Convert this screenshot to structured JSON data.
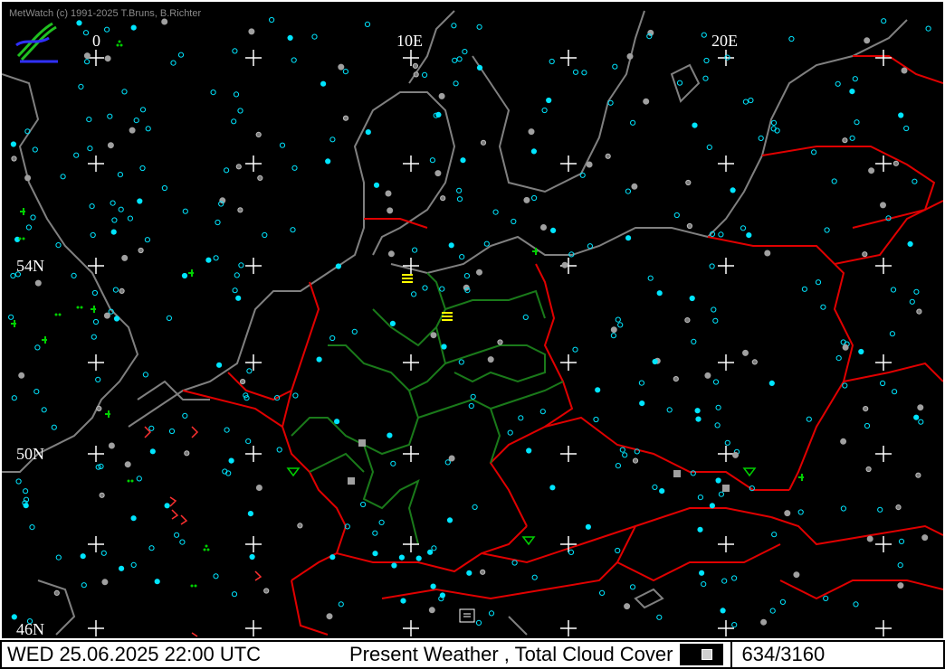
{
  "app": {
    "copyright": "MetWatch  (c) 1991-2025 T.Bruns, B.Richter"
  },
  "map": {
    "longitude_labels": [
      "0",
      "10E",
      "20E"
    ],
    "latitude_labels": [
      "54N",
      "50N",
      "46N"
    ],
    "colors": {
      "coastline": "#808080",
      "country_border": "#e00000",
      "state_border": "#1a7a1a",
      "cloud_symbol": "#00e5ff",
      "grid_cross": "#ffffff",
      "precip_symbol": "#00d000",
      "thunder_symbol": "#ff3030",
      "fog_symbol": "#ffff00"
    },
    "icons": [
      "metwatch-logo-icon",
      "grid-cross-icon",
      "cloud-cover-symbol-icon",
      "present-weather-symbol-icon"
    ]
  },
  "status_bar": {
    "datetime": "WED 25.06.2025 22:00 UTC",
    "product": "Present Weather    , Total Cloud Cover",
    "station_count": "634/3160"
  }
}
